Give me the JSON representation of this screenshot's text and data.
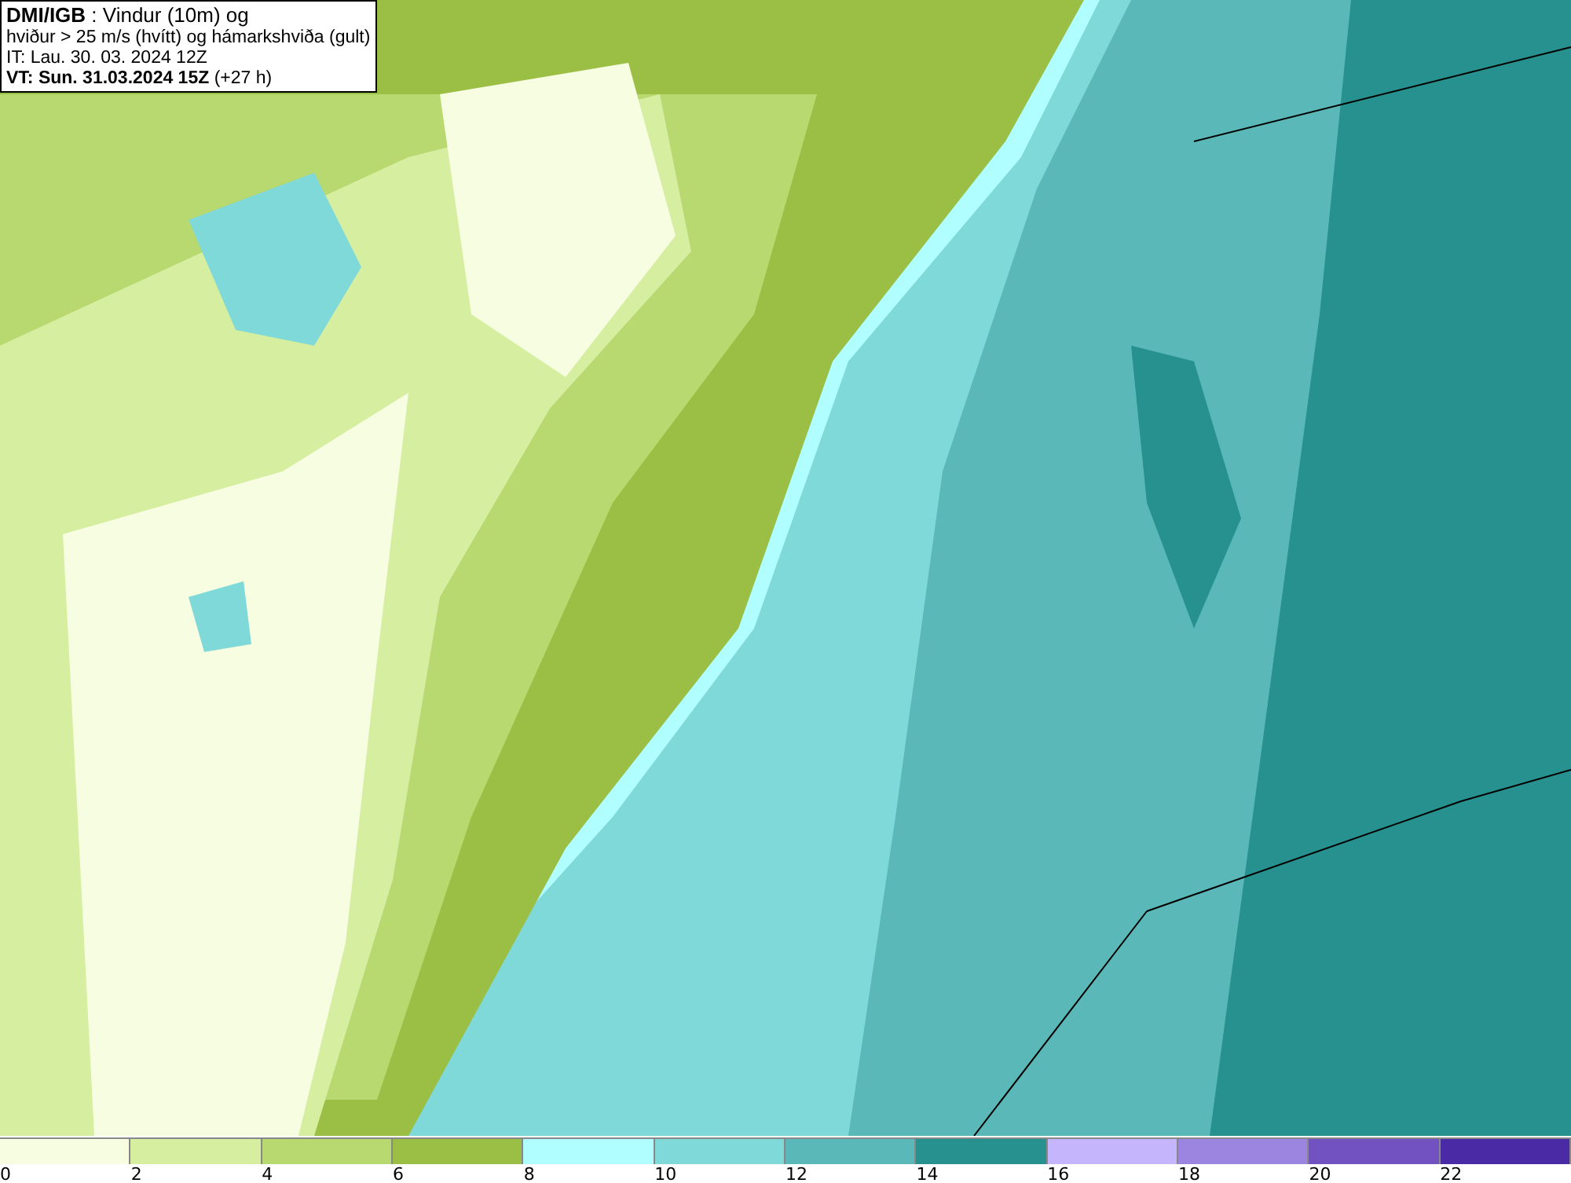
{
  "title_box": {
    "lines": [
      "**DMI/IGB** : Vindur (10m) og",
      "hviður > 25 m/s (hvítt) og hámarkshviða (gult)",
      "IT: Lau. 30. 03. 2024 12Z",
      "**VT: Sun. 31.03.2024 15Z** (+27 h)"
    ]
  },
  "legend": [
    {
      "label": "0",
      "color": "#f7fde0"
    },
    {
      "label": "2",
      "color": "#d6eea0"
    },
    {
      "label": "4",
      "color": "#b8d870"
    },
    {
      "label": "6",
      "color": "#9bbf45"
    },
    {
      "label": "8",
      "color": "#b0feff"
    },
    {
      "label": "10",
      "color": "#80d9d9"
    },
    {
      "label": "12",
      "color": "#5ab8b8"
    },
    {
      "label": "14",
      "color": "#26918e"
    },
    {
      "label": "16",
      "color": "#c4b5fd"
    },
    {
      "label": "18",
      "color": "#9c85e0"
    },
    {
      "label": "20",
      "color": "#7152c0"
    },
    {
      "label": "22",
      "color": "#4a2aa5"
    }
  ]
}
